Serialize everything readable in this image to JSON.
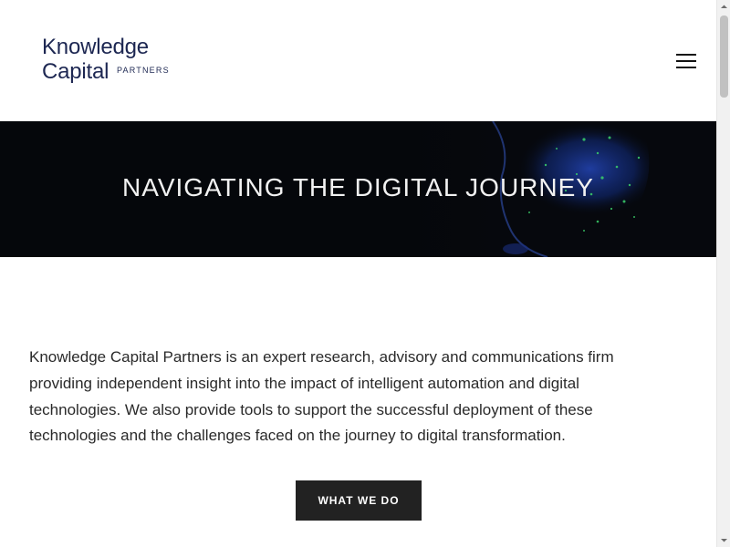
{
  "header": {
    "logo": {
      "line1": "Knowledge",
      "line2": "Capital",
      "line3": "PARTNERS"
    },
    "menu_icon": "hamburger-menu-icon"
  },
  "hero": {
    "title": "NAVIGATING THE DIGITAL JOURNEY"
  },
  "main": {
    "intro_text": "Knowledge Capital Partners is an expert research, advisory and communications firm providing independent insight into the impact of intelligent automation and digital technologies. We also provide tools to support the successful deployment of these technologies and the challenges faced on the journey to digital transformation.",
    "cta_label": "WHAT WE DO"
  },
  "colors": {
    "brand": "#1d2752",
    "cta_bg": "#222222",
    "hero_bg": "#05070b",
    "hero_accent": "#1e3fa8",
    "hero_sparkle": "#3bd16a"
  }
}
